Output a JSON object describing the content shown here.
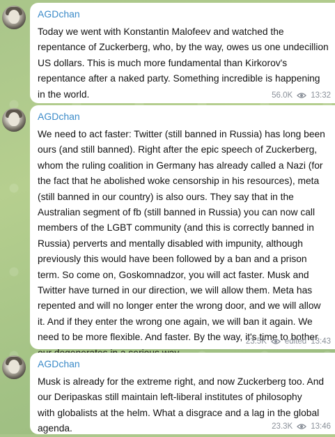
{
  "messages": [
    {
      "author": "AGDchan",
      "text": "Today we went with Konstantin Malofeev and watched the\nrepentance of Zuckerberg, who, by the way, owes us one undecillion\nUS dollars. This is much more fundamental than Kirkorov's\nrepentance after a naked party. Something incredible is happening\nin the world.",
      "views": "56.0K",
      "edited": "",
      "time": "13:32"
    },
    {
      "author": "AGDchan",
      "text": "We need to act faster: Twitter (still banned in Russia) has long been\nours (and still banned). Right after the epic speech of Zuckerberg,\nwhom the ruling coalition in Germany has already called a Nazi (for\nthe fact that he abolished woke censorship in his resources), meta\n(still banned in our country) is also ours. They say that in the\nAustralian segment of fb (still banned in Russia) you can now call\nmembers of the LGBT community (and this is correctly banned in\nRussia) perverts and mentally disabled with impunity, although\npreviously this would have been followed by a ban and a prison\nterm. So come on, Goskomnadzor, you will act faster. Musk and\nTwitter have turned in our direction, we will allow them. Meta has\nrepented and will no longer enter the wrong door, and we will allow\nit. And if they enter the wrong one again, we will ban it again. We\nneed to be more flexible. And faster. By the way, it's time to bother\nour degenerates in a serious way.",
      "views": "23.5K",
      "edited": "edited",
      "time": "13:43"
    },
    {
      "author": "AGDchan",
      "text": "Musk is already for the extreme right, and now Zuckerberg too. And\nour Deripaskas still maintain left-liberal institutes of philosophy\nwith globalists at the helm. What a disgrace and a lag in the global\nagenda.",
      "views": "23.3K",
      "edited": "",
      "time": "13:46"
    }
  ],
  "icons": {
    "views": "eye-icon"
  },
  "colors": {
    "author": "#3a8ac8",
    "meta": "#8a9099",
    "bubble": "#ffffff",
    "background": "#a9c58a"
  }
}
